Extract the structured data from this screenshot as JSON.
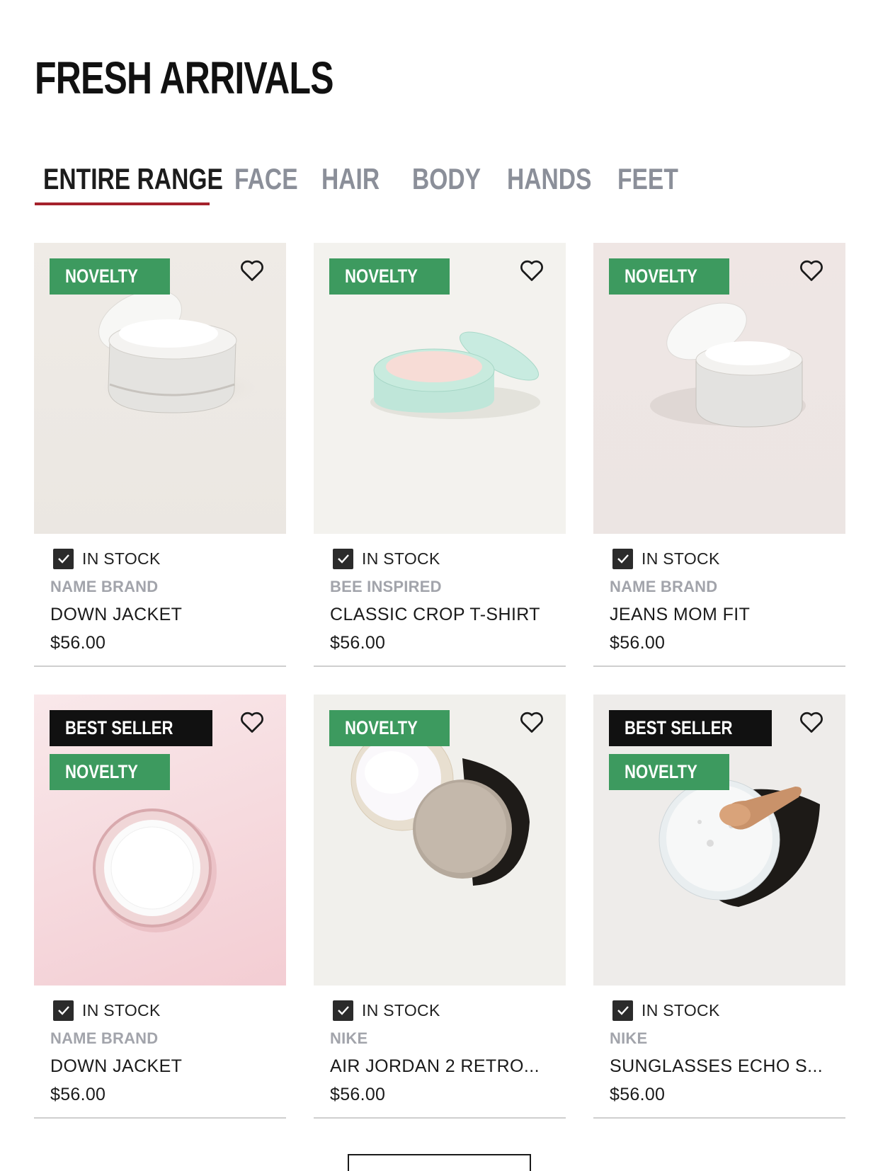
{
  "header": {
    "title": "FRESH ARRIVALS"
  },
  "tabs": [
    {
      "label": "ENTIRE RANGE",
      "active": true
    },
    {
      "label": "FACE",
      "active": false
    },
    {
      "label": "HAIR",
      "active": false
    },
    {
      "label": "BODY",
      "active": false
    },
    {
      "label": "HANDS",
      "active": false
    },
    {
      "label": "FEET",
      "active": false
    }
  ],
  "colors": {
    "accent_underline": "#a5222c",
    "novelty_badge": "#3d9a5f",
    "bestseller_badge": "#111111",
    "muted_text": "#8b8f99"
  },
  "products": [
    {
      "badges": [
        "NOVELTY"
      ],
      "stock": "IN STOCK",
      "brand": "NAME BRAND",
      "name": "DOWN JACKET",
      "price": "$56.00",
      "icon": "heart-icon"
    },
    {
      "badges": [
        "NOVELTY"
      ],
      "stock": "IN STOCK",
      "brand": "BEE INSPIRED",
      "name": "CLASSIC CROP T-SHIRT",
      "price": "$56.00",
      "icon": "heart-icon"
    },
    {
      "badges": [
        "NOVELTY"
      ],
      "stock": "IN STOCK",
      "brand": "NAME BRAND",
      "name": "JEANS MOM FIT",
      "price": "$56.00",
      "icon": "heart-icon"
    },
    {
      "badges": [
        "BEST SELLER",
        "NOVELTY"
      ],
      "stock": "IN STOCK",
      "brand": "NAME BRAND",
      "name": "DOWN JACKET",
      "price": "$56.00",
      "icon": "heart-icon"
    },
    {
      "badges": [
        "NOVELTY"
      ],
      "stock": "IN STOCK",
      "brand": "NIKE",
      "name": "AIR JORDAN 2 RETRO...",
      "price": "$56.00",
      "icon": "heart-icon"
    },
    {
      "badges": [
        "BEST SELLER",
        "NOVELTY"
      ],
      "stock": "IN STOCK",
      "brand": "NIKE",
      "name": "SUNGLASSES ECHO S...",
      "price": "$56.00",
      "icon": "heart-icon"
    }
  ]
}
